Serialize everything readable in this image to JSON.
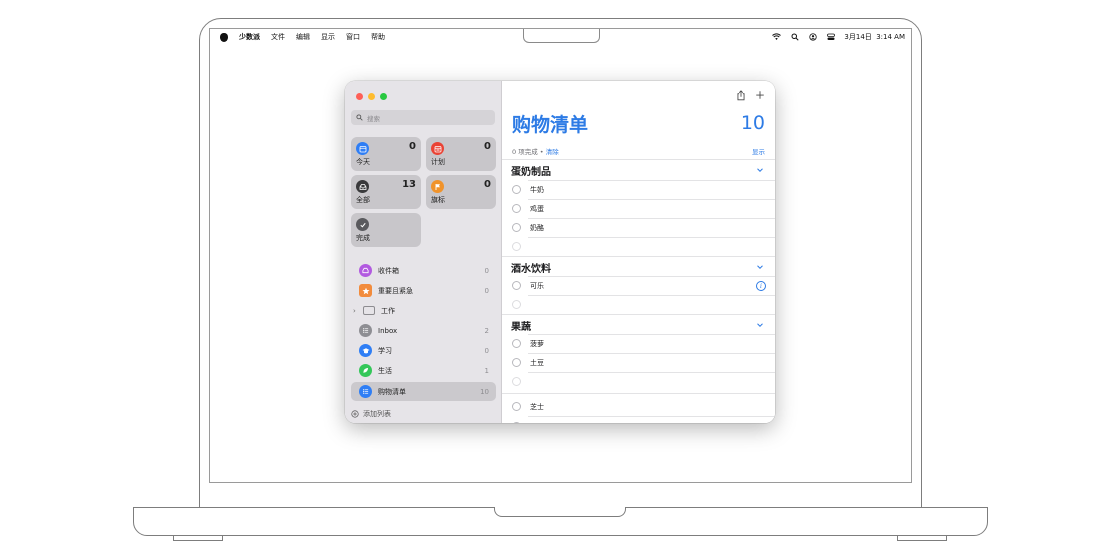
{
  "menubar": {
    "app_name": "少数派",
    "menus": [
      "文件",
      "编辑",
      "显示",
      "窗口",
      "帮助"
    ],
    "datetime": "3月14日  3:14 AM",
    "status_icons": [
      "wifi-icon",
      "spotlight-search-icon",
      "user-icon",
      "control-center-icon"
    ]
  },
  "sidebar": {
    "search_placeholder": "搜索",
    "smart_lists": [
      {
        "label": "今天",
        "count": "0",
        "icon": "calendar-today-icon",
        "color": "#2f7ef5"
      },
      {
        "label": "计划",
        "count": "0",
        "icon": "calendar-scheduled-icon",
        "color": "#ea4335"
      },
      {
        "label": "全部",
        "count": "13",
        "icon": "tray-all-icon",
        "color": "#3a3a3c"
      },
      {
        "label": "旗标",
        "count": "0",
        "icon": "flag-icon",
        "color": "#f0932b"
      },
      {
        "label": "完成",
        "icon": "checkmark-icon",
        "color": "#5a5a5e"
      }
    ],
    "lists": [
      {
        "label": "收件箱",
        "count": "0",
        "icon": "inbox-tray-icon",
        "color": "#b25ae0"
      },
      {
        "label": "重要且紧急",
        "count": "0",
        "icon": "star-icon",
        "color": "#f28b3c"
      },
      {
        "label": "工作",
        "icon": "folder-icon",
        "is_group": true
      },
      {
        "label": "Inbox",
        "count": "2",
        "icon": "list-bullet-icon",
        "color": "#8e8e93"
      },
      {
        "label": "学习",
        "count": "0",
        "icon": "graduation-cap-icon",
        "color": "#2f7ef5"
      },
      {
        "label": "生活",
        "count": "1",
        "icon": "leaf-icon",
        "color": "#34c759"
      },
      {
        "label": "购物清单",
        "count": "10",
        "icon": "list-bullet-icon",
        "color": "#2f7ef5",
        "selected": true
      }
    ],
    "add_list_label": "添加列表"
  },
  "main": {
    "title": "购物清单",
    "count": "10",
    "completed_text": "0 项完成",
    "separator": "•",
    "clear_label": "清除",
    "show_label": "显示",
    "accent": "#2d7be5",
    "sections": [
      {
        "name": "蛋奶制品",
        "items": [
          "牛奶",
          "鸡蛋",
          "奶酪",
          ""
        ]
      },
      {
        "name": "酒水饮料",
        "items": [
          "可乐",
          ""
        ]
      },
      {
        "name": "果蔬",
        "items": [
          "菠萝",
          "土豆",
          ""
        ]
      }
    ],
    "ungrouped_items": [
      "芝士"
    ]
  }
}
